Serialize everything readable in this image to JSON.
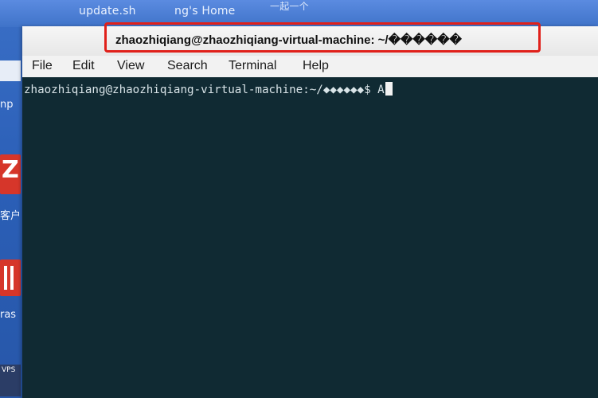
{
  "desktop": {
    "labels": [
      "update.sh",
      "ng's Home",
      "一起一个"
    ],
    "left_icon_texts": [
      "np",
      "客户",
      "ras",
      "VPS"
    ]
  },
  "window": {
    "title": "zhaozhiqiang@zhaozhiqiang-virtual-machine: ~/������",
    "menu": [
      "File",
      "Edit",
      "View",
      "Search",
      "Terminal",
      "Help"
    ]
  },
  "terminal": {
    "prompt": "zhaozhiqiang@zhaozhiqiang-virtual-machine:~/◆◆◆◆◆◆$ ",
    "input": "A"
  },
  "colors": {
    "terminal_bg": "#102a33",
    "highlight_border": "#e0201a",
    "desktop_blue": "#2f66b8"
  }
}
